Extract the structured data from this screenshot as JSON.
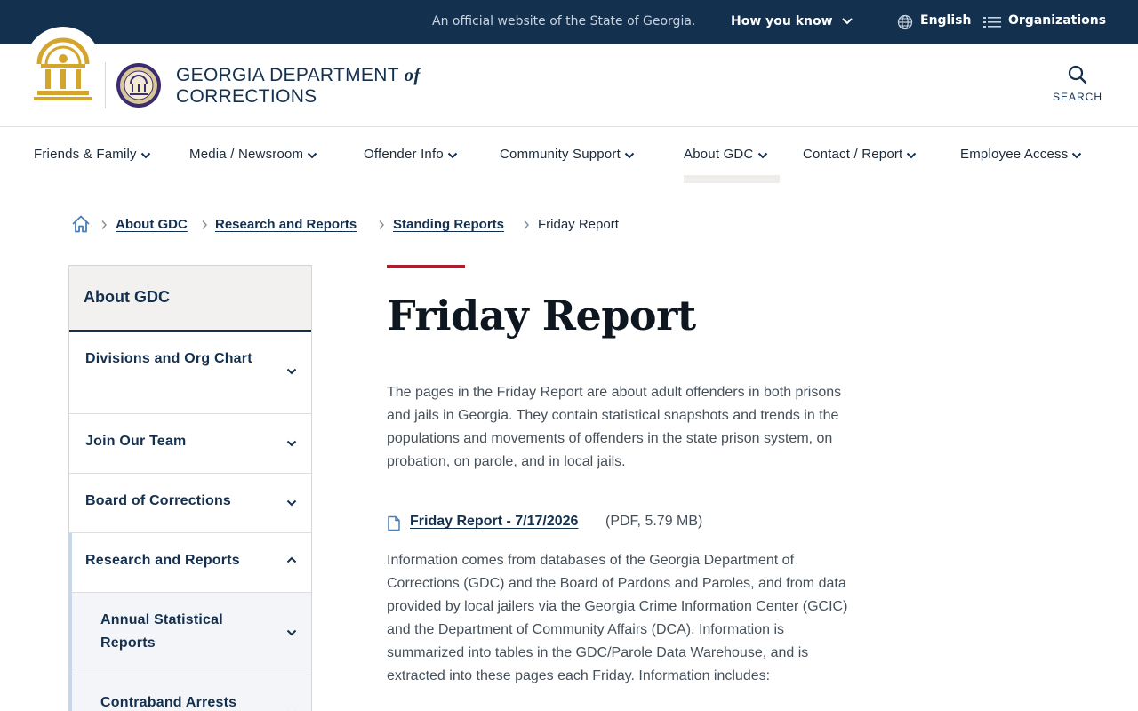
{
  "topbar": {
    "official_text": "An official website of the State of Georgia.",
    "how_you_know": "How you know",
    "language": "English",
    "organizations": "Organizations"
  },
  "header": {
    "agency_line1": "GEORGIA DEPARTMENT",
    "agency_of": "of",
    "agency_line2": "CORRECTIONS",
    "search_label": "SEARCH"
  },
  "nav": {
    "items": [
      {
        "label": "Friends & Family"
      },
      {
        "label": "Media / Newsroom"
      },
      {
        "label": "Offender Info"
      },
      {
        "label": "Community Support"
      },
      {
        "label": "About GDC"
      },
      {
        "label": "Contact / Report"
      },
      {
        "label": "Employee Access"
      }
    ],
    "active": "About GDC"
  },
  "breadcrumb": {
    "items": [
      "About GDC",
      "Research and Reports",
      "Standing Reports"
    ],
    "current": "Friday Report"
  },
  "sidebar": {
    "heading": "About GDC",
    "items": [
      {
        "label": "Divisions and Org Chart"
      },
      {
        "label": "Join Our Team"
      },
      {
        "label": "Board of Corrections"
      },
      {
        "label": "Research and Reports"
      },
      {
        "label": "Annual Statistical Reports"
      },
      {
        "label": "Contraband Arrests"
      }
    ]
  },
  "main": {
    "title": "Friday Report",
    "intro": "The pages in the Friday Report are about adult offenders in both prisons and jails in Georgia. They contain statistical snapshots and trends in the populations and movements of offenders in the state prison system, on probation, on parole, and in local jails.",
    "document": {
      "link_text": "Friday Report - 7/17/2026",
      "meta": "(PDF, 5.79 MB)"
    },
    "info": "Information comes from databases of the Georgia Department of Corrections (GDC) and the Board of Pardons and Paroles, and from data provided by local jailers via the Georgia Crime Information Center (GCIC) and the Department of Community Affairs (DCA). Information is summarized into tables in the GDC/Parole Data Warehouse, and is extracted into these pages each Friday. Information includes:"
  },
  "colors": {
    "navy": "#14304f",
    "accent_red": "#ad1f2b",
    "gold": "#d4a52c"
  }
}
